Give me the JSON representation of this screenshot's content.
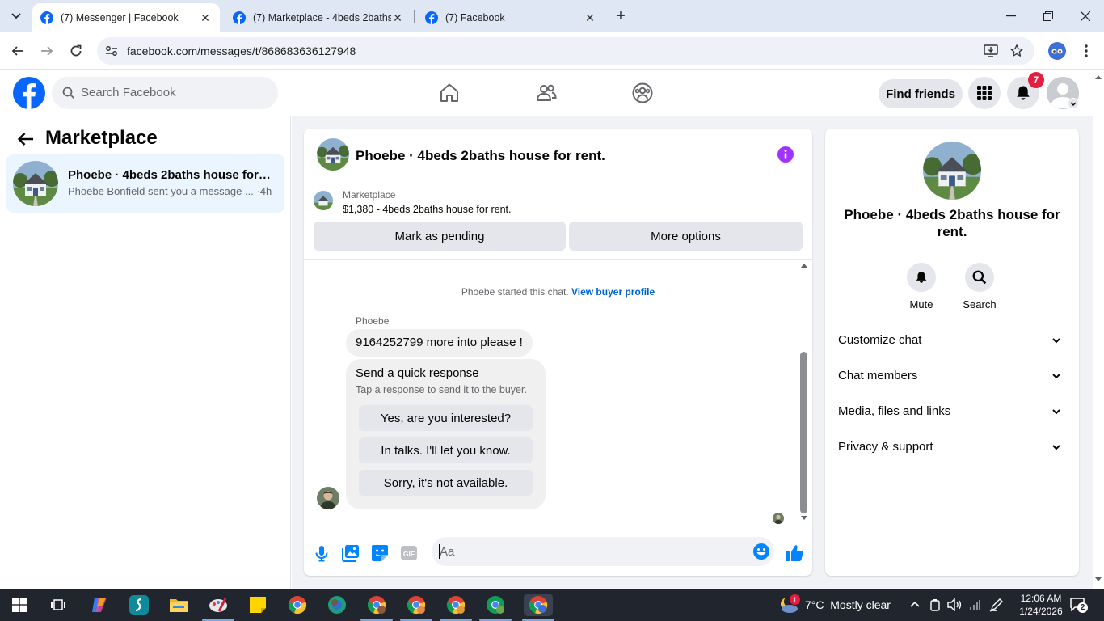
{
  "browser": {
    "tabs": [
      {
        "title": "(7) Messenger | Facebook",
        "active": true
      },
      {
        "title": "(7) Marketplace - 4beds 2baths",
        "active": false
      },
      {
        "title": "(7) Facebook",
        "active": false
      }
    ],
    "url": "facebook.com/messages/t/868683636127948"
  },
  "fb_header": {
    "search_placeholder": "Search Facebook",
    "find_friends_label": "Find friends",
    "notification_count": "7"
  },
  "sidebar": {
    "title": "Marketplace",
    "conversations": [
      {
        "name": "Phoebe · 4beds 2baths house for rent.",
        "snippet": "Phoebe Bonfield sent you a message ... ·4h"
      }
    ]
  },
  "chat": {
    "title": "Phoebe · 4beds 2baths house for rent.",
    "marketplace_label": "Marketplace",
    "listing": "$1,380 - 4beds 2baths house for rent.",
    "mark_pending_label": "Mark as pending",
    "more_options_label": "More options",
    "system_message": "Phoebe started this chat.",
    "system_link": "View buyer profile",
    "sender_name": "Phoebe",
    "message_text": "9164252799 more into please !",
    "quick_response": {
      "title": "Send a quick response",
      "subtitle": "Tap a response to send it to the buyer.",
      "options": [
        "Yes, are you interested?",
        "In talks. I'll let you know.",
        "Sorry, it's not available."
      ]
    },
    "composer_placeholder": "Aa"
  },
  "info_panel": {
    "name": "Phoebe · 4beds 2baths house for rent.",
    "actions": [
      {
        "label": "Mute"
      },
      {
        "label": "Search"
      }
    ],
    "sections": [
      "Customize chat",
      "Chat members",
      "Media, files and links",
      "Privacy & support"
    ]
  },
  "taskbar": {
    "weather_badge": "1",
    "weather": "7°C  Mostly clear",
    "time": "12:06 AM",
    "date": "1/24/2026",
    "notification_count": "2"
  },
  "colors": {
    "facebook_blue": "#0866ff",
    "messenger_accent": "#0084ff",
    "info_purple": "#a033ff",
    "selected_row": "#ebf5ff",
    "badge_red": "#e41e3f"
  }
}
